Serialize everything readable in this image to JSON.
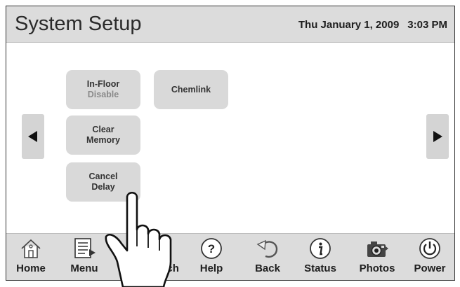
{
  "header": {
    "title": "System Setup",
    "date": "Thu January 1, 2009",
    "time": "3:03 PM"
  },
  "tiles": {
    "infloor": {
      "label": "In-Floor",
      "sub": "Disable"
    },
    "chemlink": {
      "label": "Chemlink"
    },
    "clear_memory": {
      "line1": "Clear",
      "line2": "Memory"
    },
    "cancel_delay": {
      "line1": "Cancel",
      "line2": "Delay"
    }
  },
  "nav": {
    "left_icon": "left-arrow-icon",
    "right_icon": "right-arrow-icon"
  },
  "toolbar": [
    {
      "label": "Home",
      "icon": "house-icon"
    },
    {
      "label": "Menu",
      "icon": "menu-icon"
    },
    {
      "label": "ach",
      "icon": "hidden-icon"
    },
    {
      "label": "Help",
      "icon": "help-icon"
    },
    {
      "label": "Back",
      "icon": "back-icon"
    },
    {
      "label": "Status",
      "icon": "info-icon"
    },
    {
      "label": "Photos",
      "icon": "camera-icon"
    },
    {
      "label": "Power",
      "icon": "power-icon"
    }
  ],
  "colors": {
    "panel": "#dcdcdc",
    "tile": "#d9d9d9",
    "text": "#333333",
    "disabled_text": "#8a8a8a"
  }
}
